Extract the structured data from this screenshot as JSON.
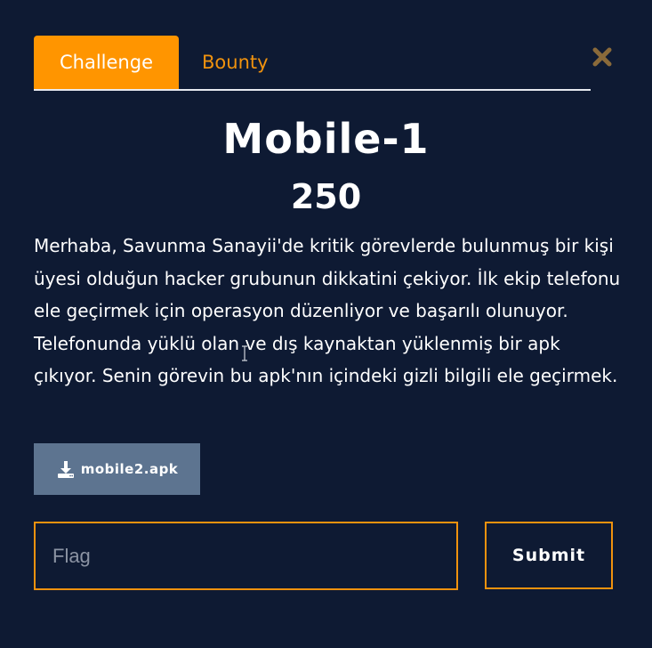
{
  "tabs": [
    {
      "label": "Challenge",
      "active": true
    },
    {
      "label": "Bounty",
      "active": false
    }
  ],
  "close_icon": "close-icon",
  "challenge": {
    "title": "Mobile-1",
    "points": "250",
    "description": "Merhaba, Savunma Sanayii'de kritik görevlerde bulunmuş bir kişi üyesi olduğun hacker grubunun dikkatini çekiyor. İlk ekip telefonu ele geçirmek için operasyon düzenliyor ve başarılı olunuyor. Telefonunda yüklü olan ve dış kaynaktan yüklenmiş bir apk çıkıyor. Senin görevin bu apk'nın içindeki gizli bilgili ele geçirmek."
  },
  "download": {
    "icon": "download-icon",
    "filename": "mobile2.apk"
  },
  "flag": {
    "placeholder": "Flag",
    "value": ""
  },
  "submit_label": "Submit",
  "colors": {
    "background": "#0e1a33",
    "accent": "#ff9500",
    "accent_text": "#f0920e",
    "download_bg": "#5d7490",
    "close_icon": "#8a6a3a"
  }
}
